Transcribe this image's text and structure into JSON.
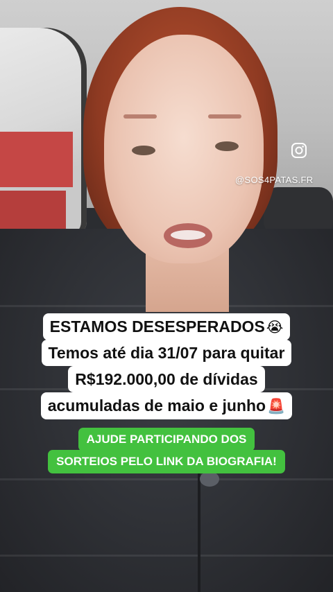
{
  "overlay": {
    "instagram_handle": "@SOS4PATAS.FR",
    "headline_lines": [
      {
        "text": "ESTAMOS DESESPERADOS",
        "emoji": "😭"
      },
      {
        "text": "Temos até dia 31/07 para quitar",
        "emoji": ""
      },
      {
        "text": "R$192.000,00 de dívidas",
        "emoji": ""
      },
      {
        "text": "acumuladas de maio e junho",
        "emoji": "🚨"
      }
    ],
    "cta_lines": [
      "AJUDE PARTICIPANDO DOS",
      "SORTEIOS PELO LINK DA BIOGRAFIA!"
    ]
  },
  "icons": {
    "instagram": "instagram-icon"
  },
  "colors": {
    "caption_bg": "#ffffff",
    "cta_bg": "#43c13f",
    "cta_text": "#ffffff"
  }
}
